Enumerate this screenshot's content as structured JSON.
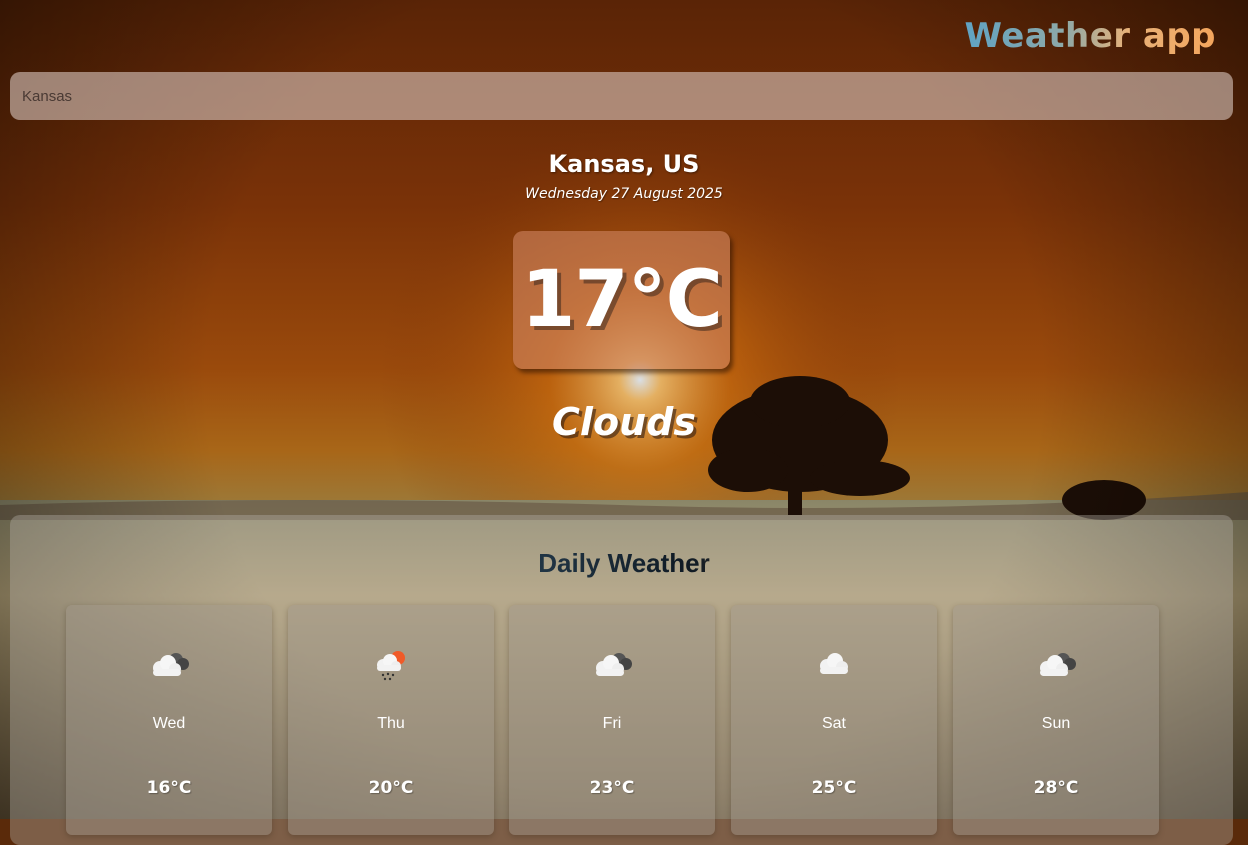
{
  "header": {
    "title": "Weather app"
  },
  "search": {
    "value": "Kansas"
  },
  "current": {
    "location": "Kansas, US",
    "date": "Wednesday 27 August 2025",
    "temperature": "17°C",
    "condition": "Clouds"
  },
  "daily": {
    "title": "Daily Weather",
    "days": [
      {
        "day": "Wed",
        "temp": "16°C",
        "icon": "broken-clouds-icon"
      },
      {
        "day": "Thu",
        "temp": "20°C",
        "icon": "rain-sun-icon"
      },
      {
        "day": "Fri",
        "temp": "23°C",
        "icon": "broken-clouds-icon"
      },
      {
        "day": "Sat",
        "temp": "25°C",
        "icon": "cloud-icon"
      },
      {
        "day": "Sun",
        "temp": "28°C",
        "icon": "broken-clouds-icon"
      }
    ]
  },
  "colors": {
    "title_gradient": [
      "#5fa3c4",
      "#f4a55c"
    ],
    "daily_title_gradient": [
      "#2f6d94",
      "#0f1a24",
      "#d18a40"
    ]
  }
}
